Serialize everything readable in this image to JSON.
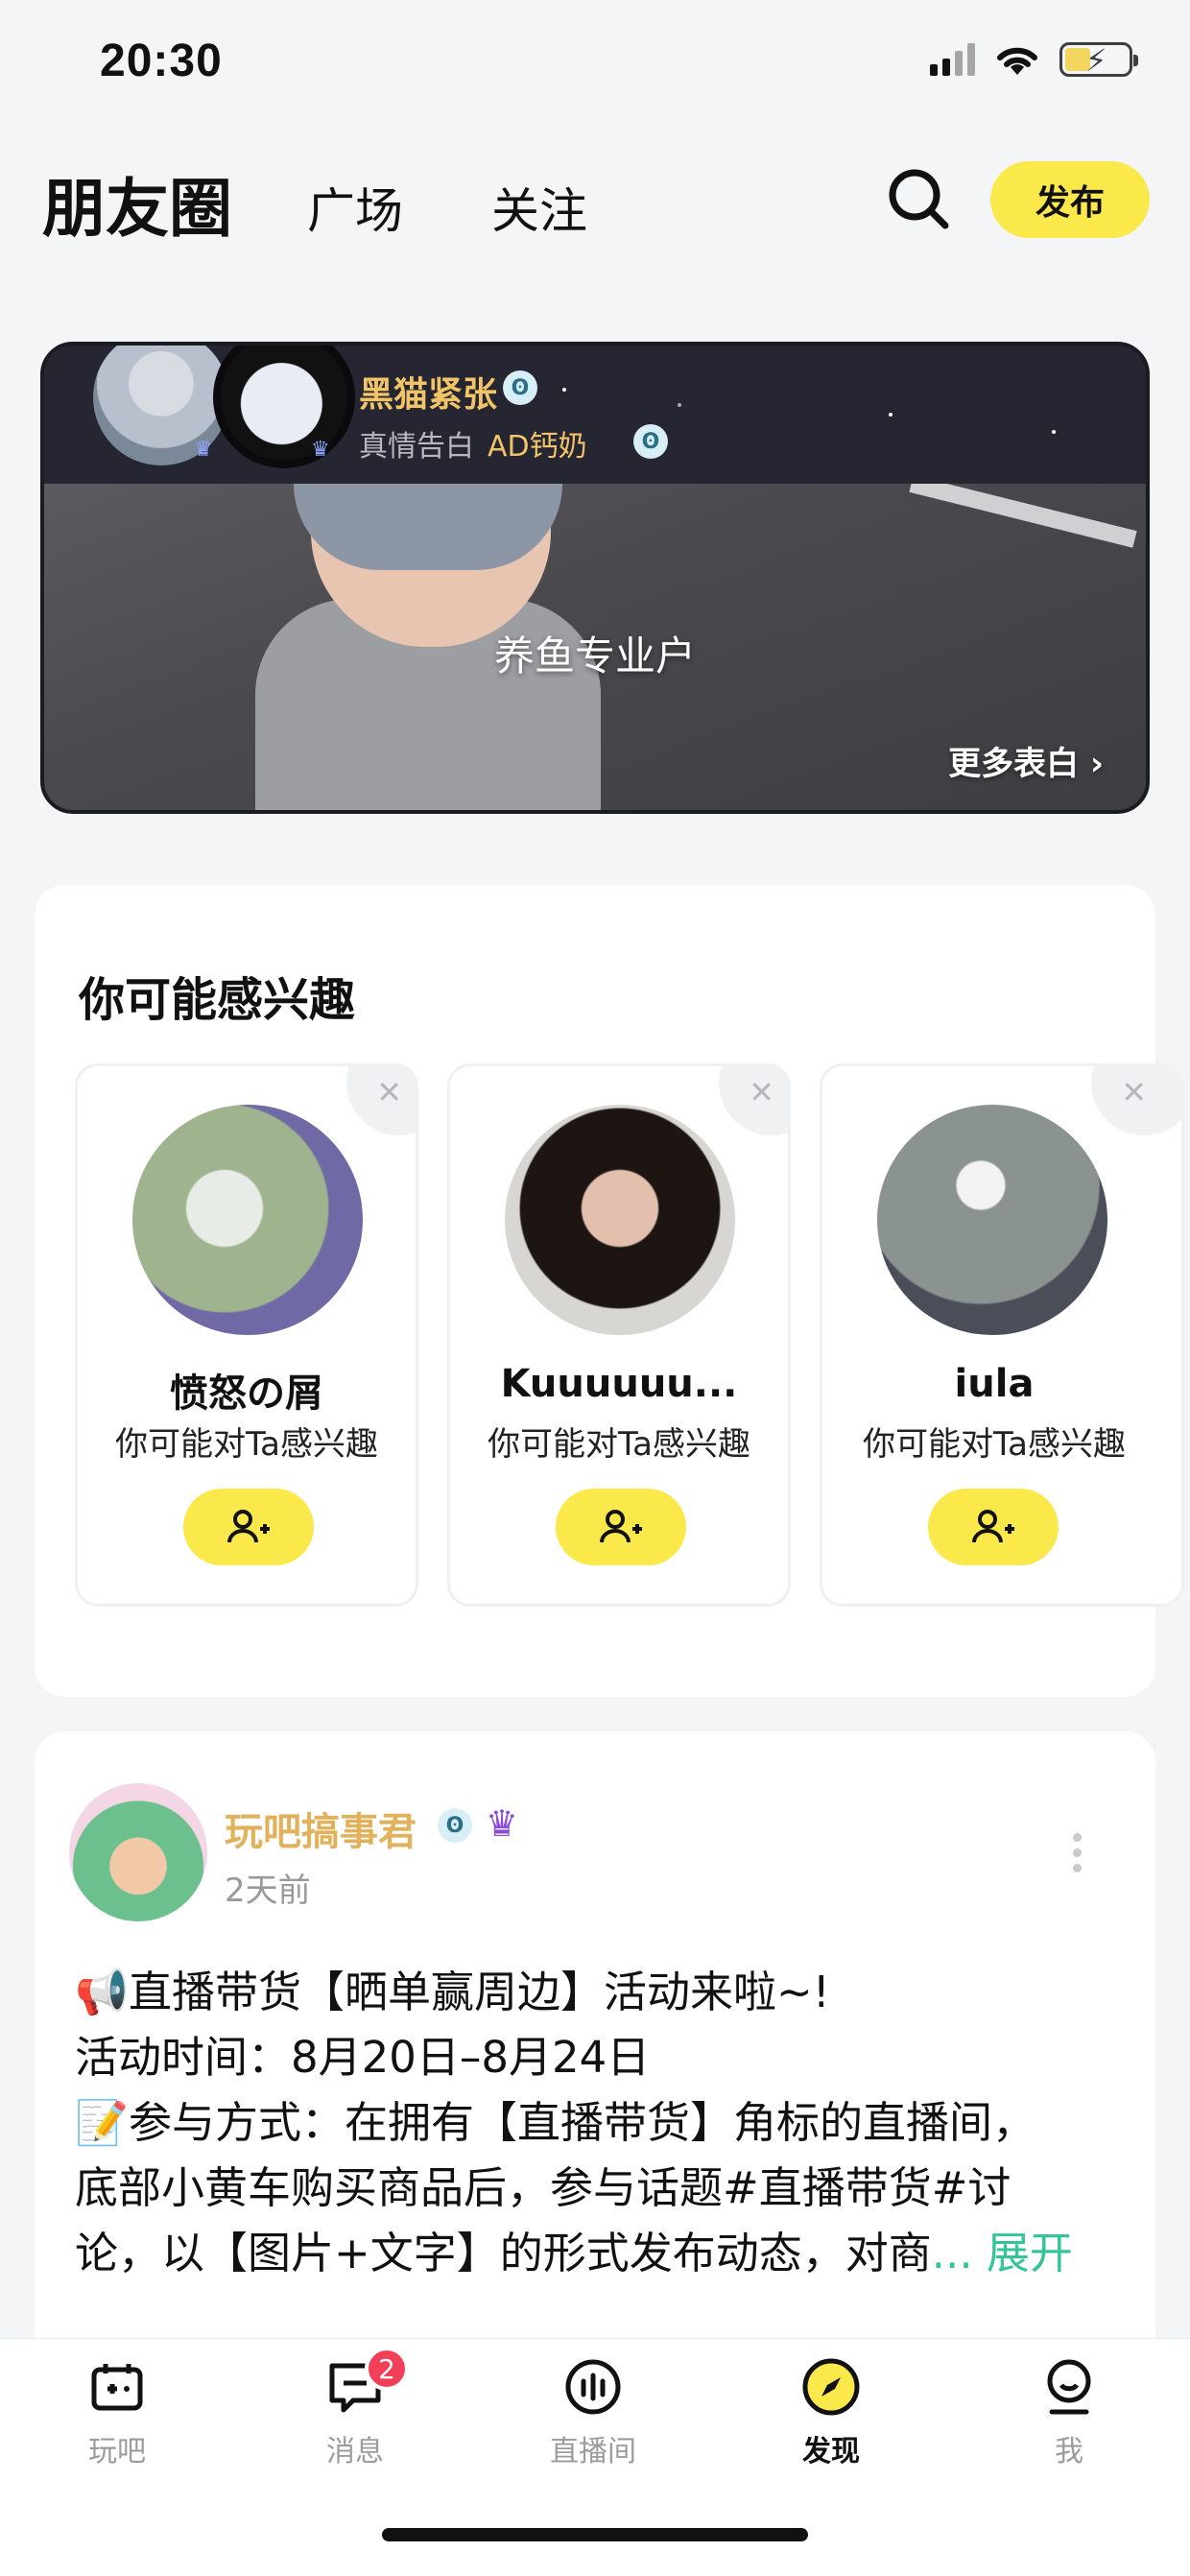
{
  "status": {
    "time": "20:30"
  },
  "header": {
    "title": "朋友圈",
    "tabs": [
      "广场",
      "关注"
    ],
    "publish_label": "发布"
  },
  "banner": {
    "name": "黑猫紧张",
    "sub_label": "真情告白",
    "sub_name": "AD钙奶",
    "caption": "养鱼专业户",
    "more_label": "更多表白 ›"
  },
  "recommend": {
    "title": "你可能感兴趣",
    "items": [
      {
        "name": "愤怒の屑",
        "hint": "你可能对Ta感兴趣",
        "avatar_color": "#7f9a6c"
      },
      {
        "name": "Kuuuuuu...",
        "hint": "你可能对Ta感兴趣",
        "avatar_color": "#3a2c28"
      },
      {
        "name": "iula",
        "hint": "你可能对Ta感兴趣",
        "avatar_color": "#8a9390"
      }
    ]
  },
  "post": {
    "author": "玩吧搞事君",
    "time": "2天前",
    "lines": [
      "📢直播带货【晒单赢周边】活动来啦~!",
      "活动时间：8月20日–8月24日",
      "📝参与方式：在拥有【直播带货】角标的直播间，",
      "底部小黄车购买商品后，参与话题#直播带货#讨",
      "论，以【图片+文字】的形式发布动态，对商"
    ],
    "expand_label": "... 展开"
  },
  "tabbar": {
    "items": [
      {
        "label": "玩吧",
        "icon": "game-icon"
      },
      {
        "label": "消息",
        "icon": "message-icon"
      },
      {
        "label": "直播间",
        "icon": "live-icon"
      },
      {
        "label": "发现",
        "icon": "discover-icon"
      },
      {
        "label": "我",
        "icon": "profile-icon"
      }
    ],
    "message_badge": "2",
    "active": "发现"
  },
  "colors": {
    "accent_yellow": "#fbe84b",
    "gold_name": "#e1b15c",
    "link_green": "#35c39a",
    "badge_red": "#f24059"
  }
}
